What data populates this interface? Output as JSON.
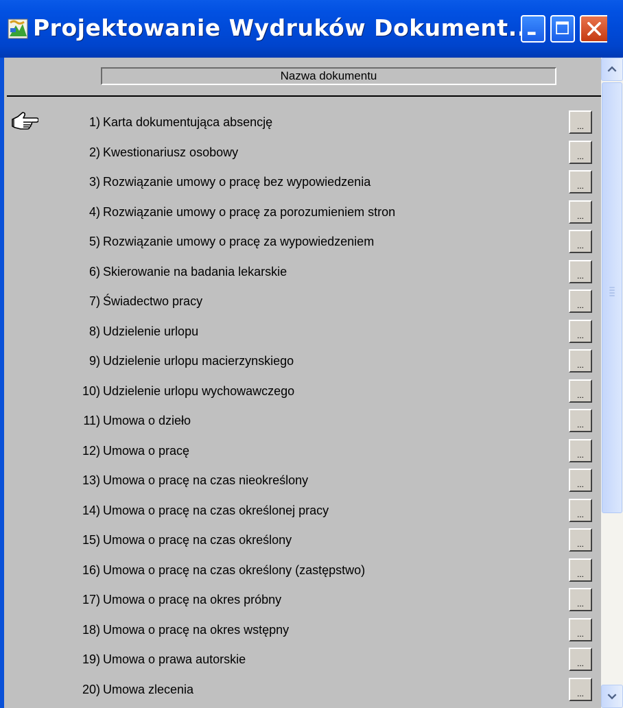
{
  "window": {
    "title": "Projektowanie Wydruków Dokument..."
  },
  "table": {
    "header": "Nazwa dokumentu",
    "button_label": "...",
    "rows": [
      {
        "num": "1)",
        "name": "Karta dokumentująca absencję"
      },
      {
        "num": "2)",
        "name": "Kwestionariusz osobowy"
      },
      {
        "num": "3)",
        "name": "Rozwiązanie umowy o pracę bez wypowiedzenia"
      },
      {
        "num": "4)",
        "name": "Rozwiązanie umowy o pracę za porozumieniem stron"
      },
      {
        "num": "5)",
        "name": "Rozwiązanie umowy o pracę za wypowiedzeniem"
      },
      {
        "num": "6)",
        "name": "Skierowanie na badania lekarskie"
      },
      {
        "num": "7)",
        "name": "Świadectwo pracy"
      },
      {
        "num": "8)",
        "name": "Udzielenie urlopu"
      },
      {
        "num": "9)",
        "name": "Udzielenie urlopu macierzynskiego"
      },
      {
        "num": "10)",
        "name": "Udzielenie urlopu wychowawczego"
      },
      {
        "num": "11)",
        "name": "Umowa o dzieło"
      },
      {
        "num": "12)",
        "name": "Umowa o pracę"
      },
      {
        "num": "13)",
        "name": "Umowa o pracę na czas nieokreślony"
      },
      {
        "num": "14)",
        "name": "Umowa o pracę na czas określonej pracy"
      },
      {
        "num": "15)",
        "name": "Umowa o pracę na czas określony"
      },
      {
        "num": "16)",
        "name": "Umowa o pracę na czas określony (zastępstwo)"
      },
      {
        "num": "17)",
        "name": "Umowa o pracę na okres próbny"
      },
      {
        "num": "18)",
        "name": "Umowa o pracę na okres wstępny"
      },
      {
        "num": "19)",
        "name": "Umowa o prawa autorskie"
      },
      {
        "num": "20)",
        "name": "Umowa zlecenia"
      }
    ]
  },
  "icons": {
    "app": "app-icon",
    "pointer": "hand-pointer-icon",
    "minimize": "minimize-icon",
    "maximize": "maximize-icon",
    "close": "close-icon",
    "scroll_up": "chevron-up-icon",
    "scroll_down": "chevron-down-icon"
  },
  "colors": {
    "titlebar": "#0054e3",
    "grid_background": "#c0c0c0",
    "close_button": "#d8542c"
  }
}
